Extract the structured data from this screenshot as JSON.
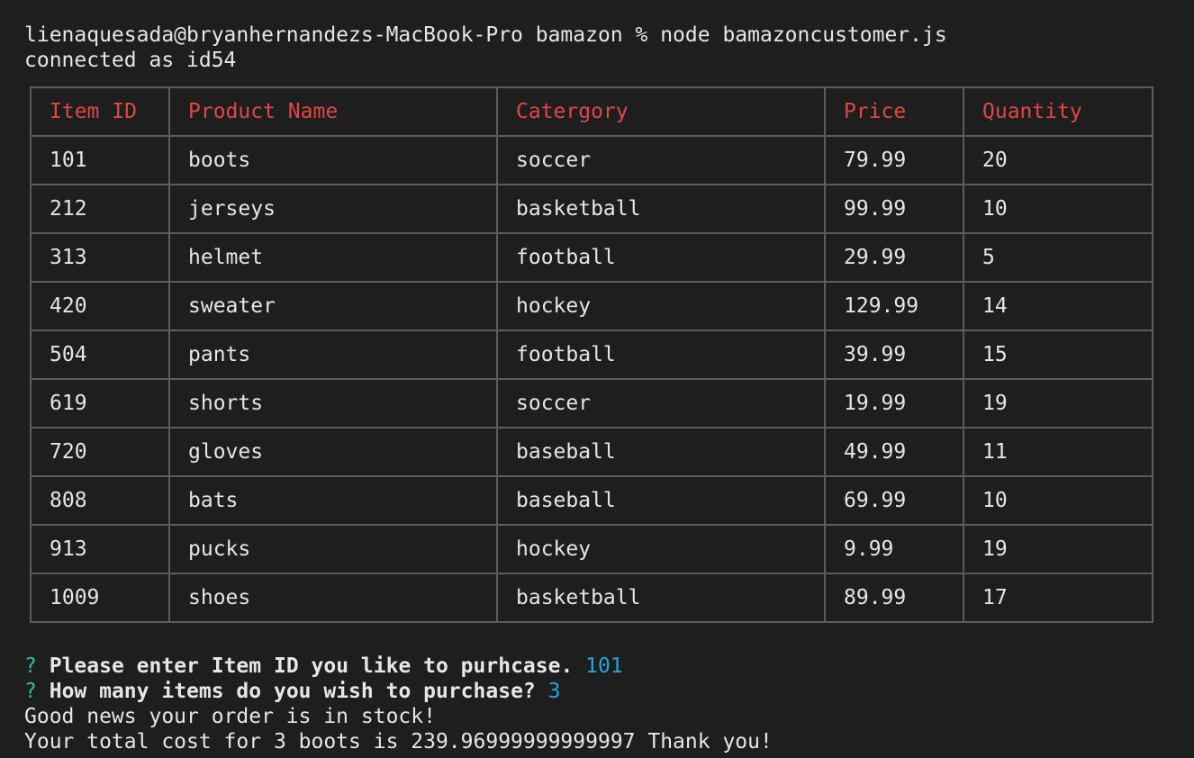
{
  "terminal": {
    "command_line": "lienaquesada@bryanhernandezs-MacBook-Pro bamazon % node bamazoncustomer.js",
    "connected_line": "connected as id54"
  },
  "table": {
    "headers": [
      "Item ID",
      "Product Name",
      "Catergory",
      "Price",
      "Quantity"
    ],
    "rows": [
      [
        "101",
        "boots",
        "soccer",
        "79.99",
        "20"
      ],
      [
        "212",
        "jerseys",
        "basketball",
        "99.99",
        "10"
      ],
      [
        "313",
        "helmet",
        "football",
        "29.99",
        "5"
      ],
      [
        "420",
        "sweater",
        "hockey",
        "129.99",
        "14"
      ],
      [
        "504",
        "pants",
        "football",
        "39.99",
        "15"
      ],
      [
        "619",
        "shorts",
        "soccer",
        "19.99",
        "19"
      ],
      [
        "720",
        "gloves",
        "baseball",
        "49.99",
        "11"
      ],
      [
        "808",
        "bats",
        "baseball",
        "69.99",
        "10"
      ],
      [
        "913",
        "pucks",
        "hockey",
        "9.99",
        "19"
      ],
      [
        "1009",
        "shoes",
        "basketball",
        "89.99",
        "17"
      ]
    ]
  },
  "prompts": [
    {
      "marker": "?",
      "question": "Please enter Item ID you like to purhcase.",
      "answer": "101"
    },
    {
      "marker": "?",
      "question": "How many items do you wish to purchase?",
      "answer": "3"
    }
  ],
  "output": {
    "stock_message": "Good news your order is in stock!",
    "total_message": "Your total cost for 3 boots is 239.96999999999997 Thank you!"
  },
  "colors": {
    "background": "#1e1e1e",
    "header_text": "#e04646",
    "prompt_marker": "#2fbfa6",
    "answer_text": "#22a6d8",
    "border": "#5c5c5c"
  }
}
